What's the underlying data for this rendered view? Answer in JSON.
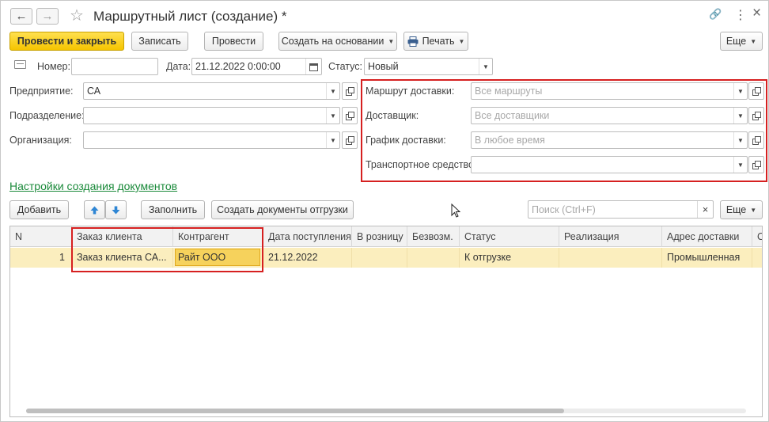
{
  "window": {
    "title": "Маршрутный лист (создание) *",
    "back": "←",
    "forward": "→",
    "star": "☆",
    "link": "🔗",
    "more": "⋮",
    "close": "×"
  },
  "toolbar": {
    "post_close": "Провести и закрыть",
    "save": "Записать",
    "post": "Провести",
    "create_based": "Создать на основании",
    "print": "Печать",
    "more": "Еще"
  },
  "header": {
    "number_label": "Номер:",
    "number_value": "",
    "date_label": "Дата:",
    "date_value": "21.12.2022  0:00:00",
    "status_label": "Статус:",
    "status_value": "Новый"
  },
  "left_fields": [
    {
      "label": "Предприятие:",
      "value": "СА"
    },
    {
      "label": "Подразделение:",
      "value": ""
    },
    {
      "label": "Организация:",
      "value": ""
    }
  ],
  "right_fields": [
    {
      "label": "Маршрут доставки:",
      "placeholder": "Все маршруты"
    },
    {
      "label": "Доставщик:",
      "placeholder": "Все доставщики"
    },
    {
      "label": "График доставки:",
      "placeholder": "В любое время"
    },
    {
      "label": "Транспортное средство:",
      "placeholder": ""
    }
  ],
  "settings_link": "Настройки создания документов",
  "table_toolbar": {
    "add": "Добавить",
    "fill": "Заполнить",
    "create_docs": "Создать документы отгрузки",
    "search_placeholder": "Поиск (Ctrl+F)",
    "more": "Еще"
  },
  "table": {
    "columns": [
      "N",
      "Заказ клиента",
      "Контрагент",
      "Дата поступления",
      "В розницу",
      "Безвозм.",
      "Статус",
      "Реализация",
      "Адрес доставки",
      "С"
    ],
    "rows": [
      [
        "1",
        "Заказ клиента СА...",
        "Райт ООО",
        "21.12.2022",
        "",
        "",
        "К отгрузке",
        "",
        "Промышленная",
        ""
      ]
    ]
  },
  "colors": {
    "primary_button": "#f5c400",
    "highlight_box": "#d62020",
    "link": "#1a8a3a",
    "selected_row": "#fbeebe"
  }
}
